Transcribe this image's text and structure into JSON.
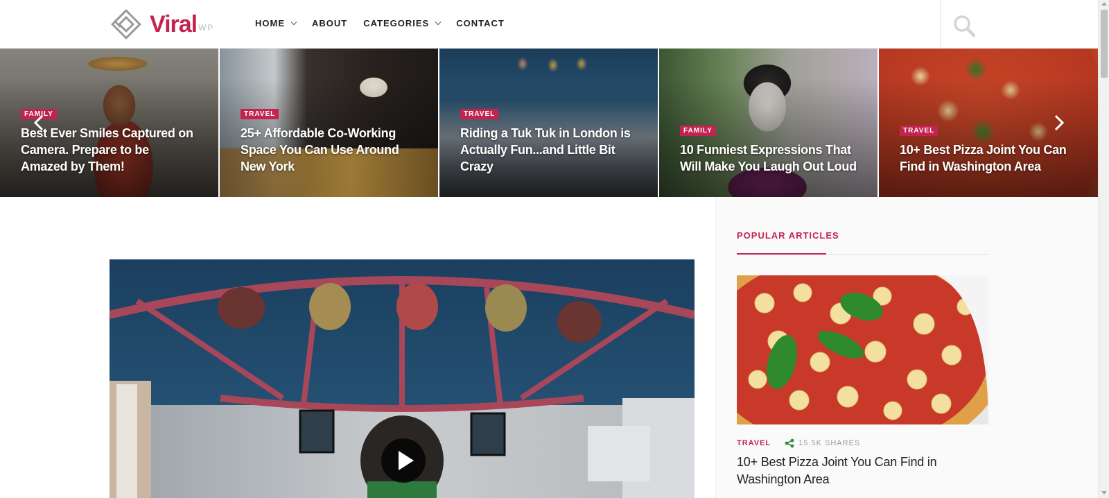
{
  "brand": {
    "name": "Viral",
    "suffix": "WP",
    "accent": "#c4234f"
  },
  "nav": {
    "items": [
      {
        "label": "HOME",
        "dropdown": true
      },
      {
        "label": "ABOUT",
        "dropdown": false
      },
      {
        "label": "CATEGORIES",
        "dropdown": true
      },
      {
        "label": "CONTACT",
        "dropdown": false
      }
    ],
    "search_icon": "search-icon"
  },
  "carousel": {
    "slides": [
      {
        "category": "FAMILY",
        "title": "Best Ever Smiles Captured on Camera. Prepare to be Amazed by Them!"
      },
      {
        "category": "TRAVEL",
        "title": "25+ Affordable Co-Working Space You Can Use Around New York"
      },
      {
        "category": "TRAVEL",
        "title": "Riding a Tuk Tuk in London is Actually Fun...and Little Bit Crazy"
      },
      {
        "category": "FAMILY",
        "title": "10 Funniest Expressions That Will Make You Laugh Out Loud"
      },
      {
        "category": "TRAVEL",
        "title": "10+ Best Pizza Joint You Can Find in Washington Area"
      }
    ],
    "prev_icon": "chevron-left-icon",
    "next_icon": "chevron-right-icon"
  },
  "featured": {
    "play_icon": "play-icon"
  },
  "sidebar": {
    "heading": "POPULAR ARTICLES",
    "article": {
      "category": "TRAVEL",
      "shares": "15.5K SHARES",
      "share_icon": "share-icon",
      "title": "10+ Best Pizza Joint You Can Find in Washington Area"
    }
  }
}
